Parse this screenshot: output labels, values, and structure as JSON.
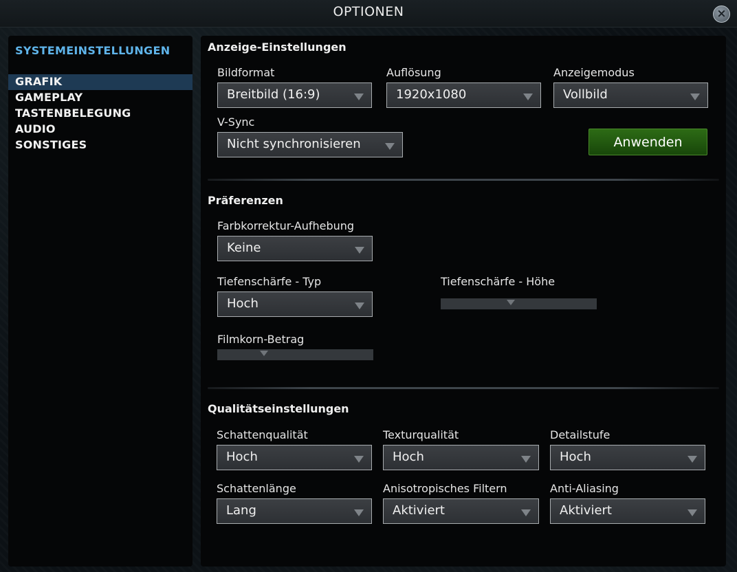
{
  "window": {
    "title": "OPTIONEN",
    "close_icon": "close-icon"
  },
  "sidebar": {
    "header": "SYSTEMEINSTELLUNGEN",
    "active_index": 0,
    "active_color": "#1e3a54",
    "header_color": "#5fb4ea",
    "items": [
      {
        "label": "GRAFIK"
      },
      {
        "label": "GAMEPLAY"
      },
      {
        "label": "TASTENBELEGUNG"
      },
      {
        "label": "AUDIO"
      },
      {
        "label": "SONSTIGES"
      }
    ]
  },
  "display": {
    "title": "Anzeige-Einstellungen",
    "aspect": {
      "label": "Bildformat",
      "value": "Breitbild (16:9)"
    },
    "resolution": {
      "label": "Auflösung",
      "value": "1920x1080"
    },
    "mode": {
      "label": "Anzeigemodus",
      "value": "Vollbild"
    },
    "vsync": {
      "label": "V-Sync",
      "value": "Nicht synchronisieren"
    },
    "apply_label": "Anwenden",
    "apply_color": "#2d6b15"
  },
  "preferences": {
    "title": "Präferenzen",
    "color_correction": {
      "label": "Farbkorrektur-Aufhebung",
      "value": "Keine"
    },
    "dof_type": {
      "label": "Tiefenschärfe - Typ",
      "value": "Hoch"
    },
    "dof_height": {
      "label": "Tiefenschärfe - Höhe",
      "fraction": 0.45
    },
    "film_grain": {
      "label": "Filmkorn-Betrag",
      "fraction": 0.3
    }
  },
  "quality": {
    "title": "Qualitätseinstellungen",
    "shadow_quality": {
      "label": "Schattenqualität",
      "value": "Hoch"
    },
    "texture_quality": {
      "label": "Texturqualität",
      "value": "Hoch"
    },
    "detail_level": {
      "label": "Detailstufe",
      "value": "Hoch"
    },
    "shadow_length": {
      "label": "Schattenlänge",
      "value": "Lang"
    },
    "anisotropic": {
      "label": "Anisotropisches Filtern",
      "value": "Aktiviert"
    },
    "anti_aliasing": {
      "label": "Anti-Aliasing",
      "value": "Aktiviert"
    }
  }
}
